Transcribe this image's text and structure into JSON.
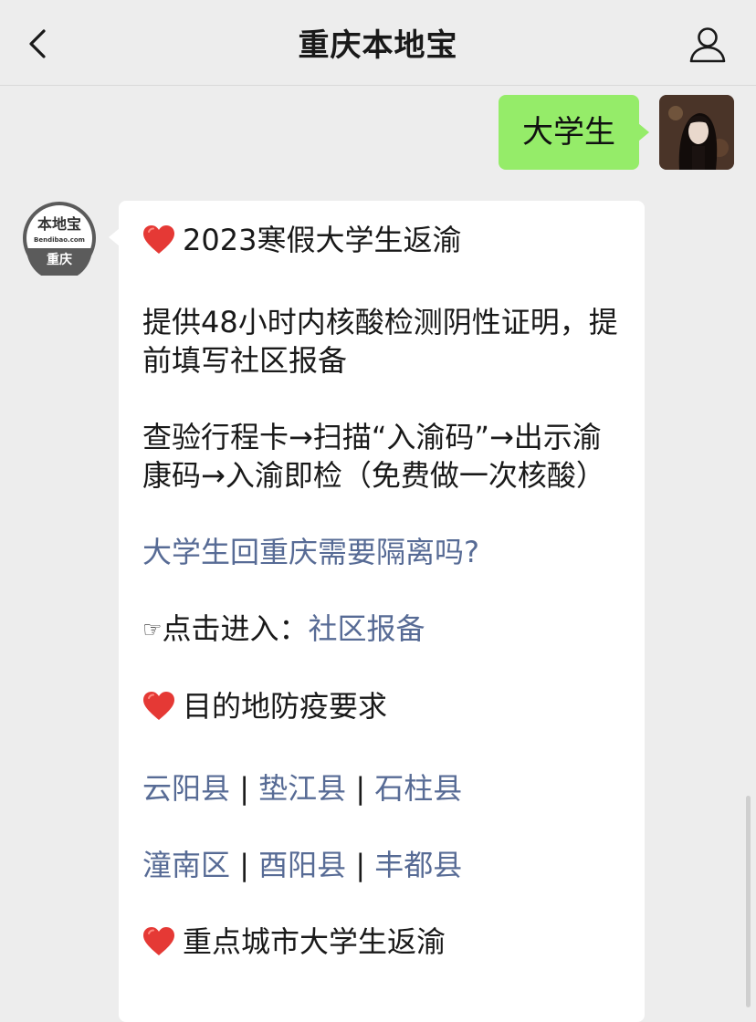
{
  "header": {
    "title": "重庆本地宝",
    "back_icon": "chevron-left-icon",
    "profile_icon": "person-icon"
  },
  "user_message": {
    "text": "大学生"
  },
  "bot_logo": {
    "top": "本地宝",
    "url": "Bendibao.com",
    "bottom": "重庆"
  },
  "bot_message": {
    "section1_title": "2023寒假大学生返渝",
    "section1_p1": "提供48小时内核酸检测阴性证明，提前填写社区报备",
    "section1_p2": "查验行程卡→扫描“入渝码”→出示渝康码→入渝即检（免费做一次核酸）",
    "link_quarantine": "大学生回重庆需要隔离吗?",
    "hand_icon": "☞",
    "click_prefix": "点击进入：",
    "link_community": "社区报备",
    "section2_title": "目的地防疫要求",
    "counties_row1": [
      "云阳县",
      "垫江县",
      "石柱县"
    ],
    "counties_row2": [
      "潼南区",
      "酉阳县",
      "丰都县"
    ],
    "separator": "|",
    "section3_title": "重点城市大学生返渝"
  },
  "colors": {
    "background": "#ededed",
    "user_bubble": "#95ec69",
    "bot_bubble": "#ffffff",
    "link": "#576b95",
    "heart": "#e53935"
  }
}
